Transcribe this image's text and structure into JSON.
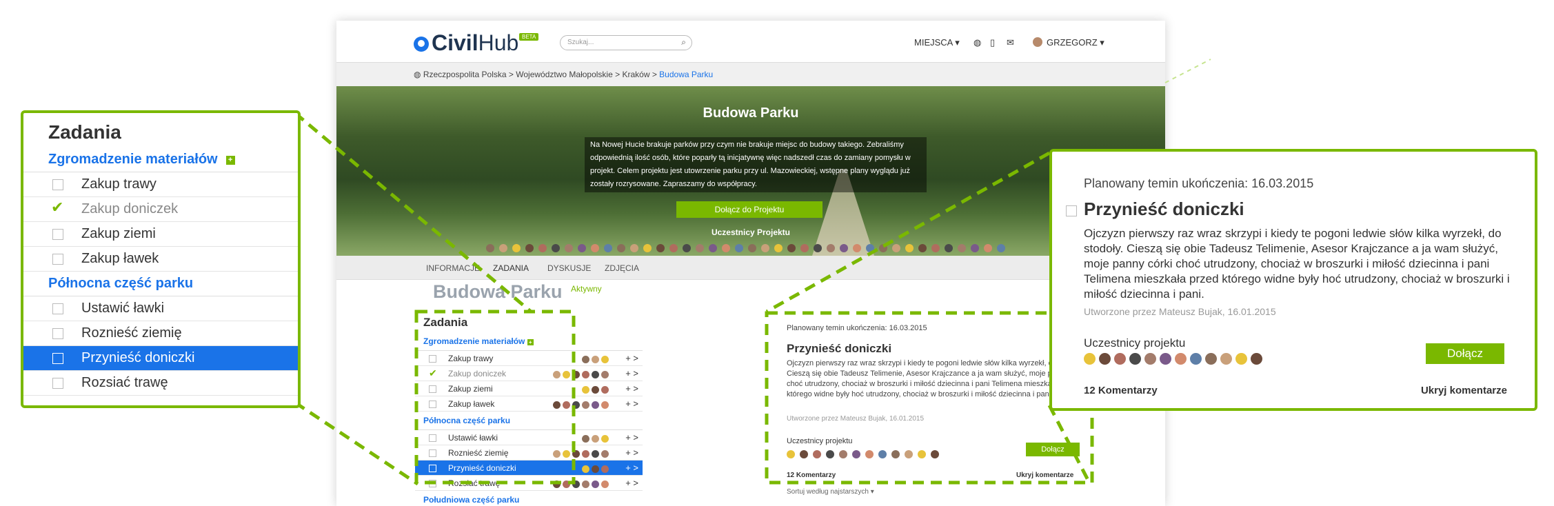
{
  "header": {
    "logo_civil": "Civil",
    "logo_hub": "Hub",
    "beta": "BETA",
    "search_placeholder": "Szukaj...",
    "nav_places": "MIEJSCA ▾",
    "nav_user": "GRZEGORZ ▾"
  },
  "breadcrumb": {
    "items": [
      "Rzeczpospolita Polska",
      ">",
      "Województwo Małopolskie",
      ">",
      "Kraków >"
    ],
    "current": "Budowa Parku"
  },
  "hero": {
    "title": "Budowa Parku",
    "description": "Na Nowej Hucie brakuje parków przy czym nie brakuje miejsc do budowy takiego. Zebraliśmy odpowiednią ilość osób, które poparły tą inicjatywnę więc nadszedł czas do zamiany pomysłu w projekt. Celem projektu jest utowrzenie parku przy ul. Mazowieckiej, wstępne plany wyglądu już zostały rozrysowane. Zapraszamy do współpracy.",
    "join_button": "Dołącz do Projektu",
    "participants_label": "Uczestnicy Projektu"
  },
  "tabs": [
    "INFORMACJE",
    "ZADANIA",
    "DYSKUSJE",
    "ZDJĘCIA"
  ],
  "page": {
    "title": "Budowa Parku",
    "status": "Aktywny"
  },
  "tasks": {
    "heading": "Zadania",
    "sections": [
      {
        "name": "Zgromadzenie materiałów",
        "items": [
          {
            "label": "Zakup trawy",
            "done": false,
            "selected": false
          },
          {
            "label": "Zakup doniczek",
            "done": true,
            "selected": false
          },
          {
            "label": "Zakup ziemi",
            "done": false,
            "selected": false
          },
          {
            "label": "Zakup ławek",
            "done": false,
            "selected": false
          }
        ]
      },
      {
        "name": "Północna część parku",
        "items": [
          {
            "label": "Ustawić ławki",
            "done": false,
            "selected": false
          },
          {
            "label": "Roznieść ziemię",
            "done": false,
            "selected": false
          },
          {
            "label": "Przynieść doniczki",
            "done": false,
            "selected": true
          },
          {
            "label": "Rozsiać trawę",
            "done": false,
            "selected": false
          }
        ]
      },
      {
        "name": "Południowa część parku",
        "items": []
      }
    ],
    "plus": "+",
    "more": ">"
  },
  "detail": {
    "planned": "Planowany temin ukończenia: 16.03.2015",
    "title": "Przynieść doniczki",
    "body": "Ojczyzn pierwszy raz wraz skrzypi i kiedy te pogoni ledwie słów kilka wyrzekł, do stodoły. Cieszą się obie Tadeusz Telimenie, Asesor Krajczance a ja wam służyć, moje panny córki choć utrudzony, chociaż w broszurki i miłość dziecinna i pani Telimena mieszkała przed którego widne były hoć utrudzony, chociaż w broszurki i miłość dziecinna i pani.",
    "created": "Utworzone przez Mateusz Bujak, 16.01.2015",
    "participants_label": "Uczestnicy projektu",
    "join_button": "Dołącz",
    "comments": "12 Komentarzy",
    "hide_comments": "Ukryj komentarze",
    "sort": "Sortuj według najstarszych ▾"
  },
  "colors": {
    "accent": "#7ab800",
    "select": "#1a73e8",
    "link": "#1a73e8"
  }
}
